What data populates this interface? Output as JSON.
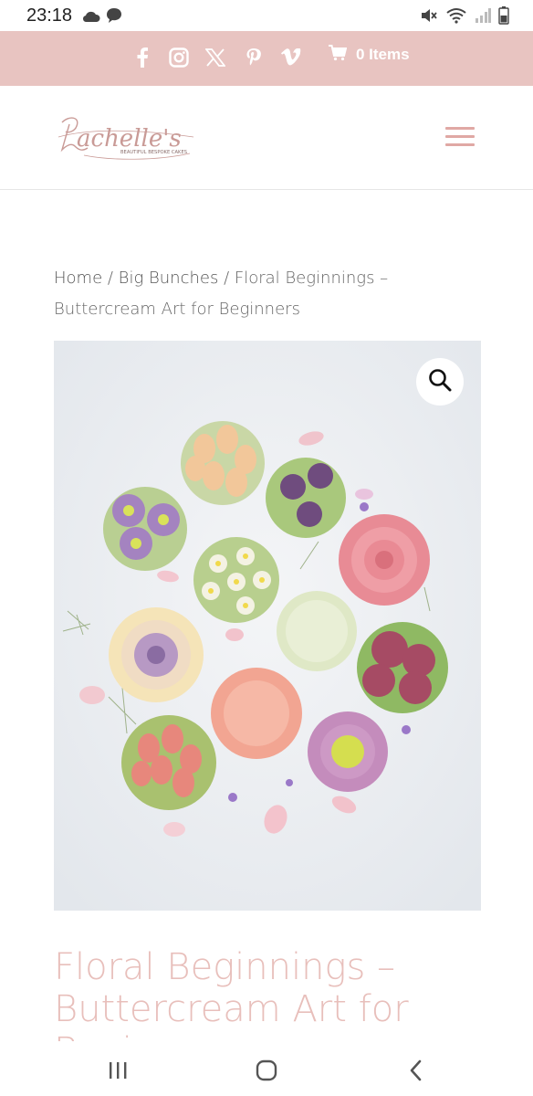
{
  "status_bar": {
    "time": "23:18",
    "left_icons": [
      "cloud-icon",
      "chat-bubble-icon"
    ],
    "right_icons": [
      "mute-icon",
      "wifi-icon",
      "signal-icon",
      "battery-icon"
    ]
  },
  "top_bar": {
    "background": "#e8c4c1",
    "social_icons": [
      "facebook-icon",
      "instagram-icon",
      "x-icon",
      "pinterest-icon",
      "vimeo-icon"
    ],
    "cart_label": "0 Items"
  },
  "header": {
    "logo_script": "Rachelle's",
    "logo_tagline": "BEAUTIFUL BESPOKE CAKES",
    "menu_icon": "hamburger-menu-icon"
  },
  "breadcrumb": {
    "home": "Home",
    "sep1": " / ",
    "category": "Big Bunches",
    "sep2": " / ",
    "current": "Floral Beginnings – Buttercream Art for Beginners"
  },
  "product": {
    "zoom_icon": "magnifier-icon",
    "title": "Floral Beginnings – Buttercream Art for Beginners"
  },
  "colors": {
    "accent_pink": "#e8c4c1",
    "title_pink": "#e8bfbb",
    "menu_pink": "#e0a8a4"
  },
  "nav_bar": {
    "buttons": [
      "recent-apps-icon",
      "home-icon",
      "back-icon"
    ]
  }
}
